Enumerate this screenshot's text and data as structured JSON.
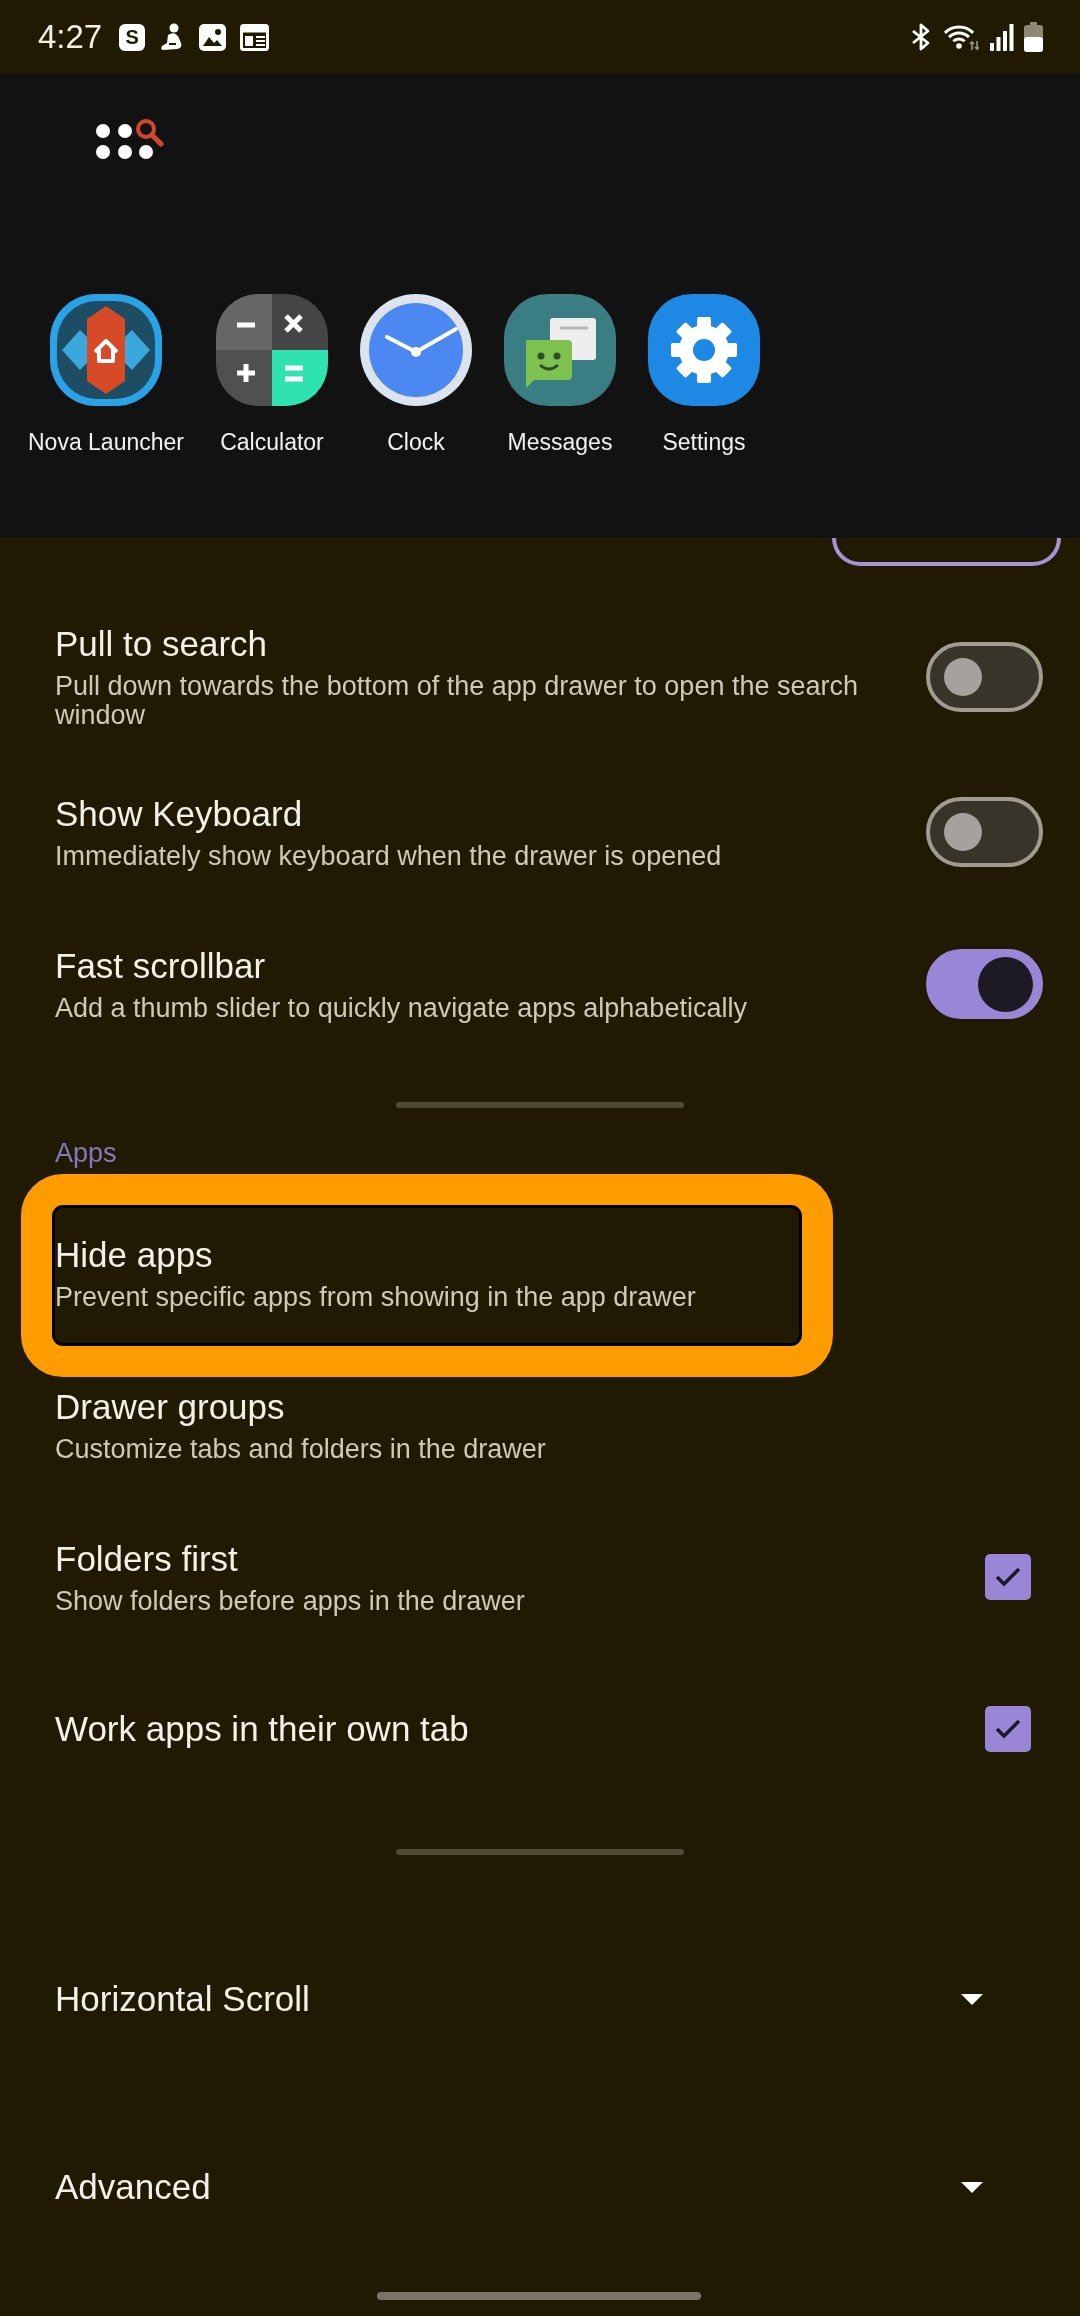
{
  "status_bar": {
    "time": "4:27",
    "notification_letter": "S"
  },
  "drawer_preview": {
    "apps": [
      {
        "kind": "launcher",
        "label": "Nova Launcher"
      },
      {
        "kind": "calculator",
        "label": "Calculator"
      },
      {
        "kind": "clock",
        "label": "Clock"
      },
      {
        "kind": "messages",
        "label": "Messages"
      },
      {
        "kind": "settings",
        "label": "Settings"
      }
    ]
  },
  "settings": {
    "groups": [
      {
        "rows": [
          {
            "kind": "toggle",
            "title": "Pull to search",
            "summary": "Pull down towards the bottom of the app drawer to open the search window",
            "on": false,
            "highlighted": false
          },
          {
            "kind": "toggle",
            "title": "Show Keyboard",
            "summary": "Immediately show keyboard when the drawer is opened",
            "on": false,
            "highlighted": false
          },
          {
            "kind": "toggle",
            "title": "Fast scrollbar",
            "summary": "Add a thumb slider to quickly navigate apps alphabetically",
            "on": true,
            "highlighted": false
          }
        ]
      },
      {
        "header": "Apps",
        "rows": [
          {
            "kind": "link",
            "title": "Hide apps",
            "summary": "Prevent specific apps from showing in the app drawer",
            "highlighted": true
          },
          {
            "kind": "link",
            "title": "Drawer groups",
            "summary": "Customize tabs and folders in the drawer",
            "highlighted": false
          },
          {
            "kind": "checkbox",
            "title": "Folders first",
            "summary": "Show folders before apps in the drawer",
            "checked": true,
            "highlighted": false
          },
          {
            "kind": "checkbox",
            "title": "Work apps in their own tab",
            "checked": true,
            "highlighted": false
          }
        ]
      }
    ],
    "expanders": [
      {
        "title": "Horizontal Scroll",
        "expanded": false
      },
      {
        "title": "Advanced",
        "expanded": false
      }
    ]
  }
}
